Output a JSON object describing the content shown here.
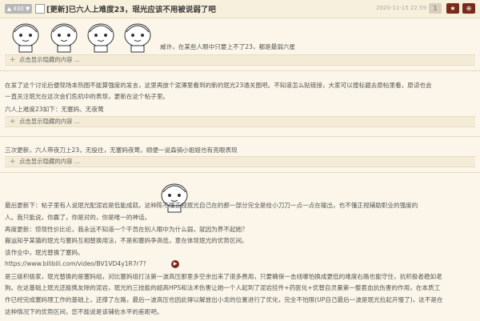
{
  "header": {
    "likes": "▲ 430 ▼",
    "title": "[更新]已六人上难度23，珉光应该不用被说弱了吧",
    "date": "2020-11-15 22:59",
    "btn_a": "1",
    "btn_b": "★",
    "btn_c": "⊕"
  },
  "section1": {
    "caption": "威许，在某些人眼中只要上不了23，都是最弱六星",
    "fold": "点击显示隐藏的内容 ..."
  },
  "section2": {
    "line1": "在发了这个讨论后便现场本热图不能算强度的发言，这里再放个泥潭里看到的新的珉光23通关图吧。不知道怎么贴链接，大家可以搜标题去原帖里看，原谅也会",
    "line2": "一直关注珉光在这次会们危机中的表现，更新在这个帖子里。",
    "line3": "六人上难度23如下：无塞妈、无夜莺",
    "fold": "点击显示隐藏的内容 ..."
  },
  "section3": {
    "line1": "三次更新，六人带夜刀上23，无投往，无塞妈夜莺，顺便一说森骑小姐姐也有亮眼表现",
    "fold": "点击显示隐藏的内容 ..."
  },
  "section4": {
    "line1": "最后更新下：帖子里有人说珉光配泥岩是低能成就，这种陈不懂正视珉光自己在的那一部分完全是给小刀刀一点一点在输出，也不懂正视辅助职业的强度的",
    "line2": "人。我只能说，你赢了，你是对的，你是唯一的神话。",
    "line3": "再度更新：惊现性价比论，我永远不知道一个干员在别人眼中为什么弱，就因为养不起她？",
    "line4": "搬运知乎某猫的珉光与塞妈互相替换用法，不是和塞妈争高低，意在体现珉光的优势区间。",
    "line5": "该作业中，珉光替换了塞妈。",
    "url": "https://www.bilibili.com/video/BV1VD4y1R7r7?",
    "pill": "▶",
    "line6": "是三级积极家，珉光替换的是塞妈组，对比塞妈组打法第一波高压那里多空余出来了很多费用，只要确保一击线哪怕换成更低的难度右路也能守住，抗积极者稳如老",
    "line7": "狗。在这基础上珉光还能携友除的泥岩，珉光的三技能的超高HPS和法术伤害让她一个人起到了泥岩挂件+药医化+优替自灵量第一整套血抗伤害的作用，在本质工",
    "line8": "作已经完成塞妈理工作的基础上，还撑了左路，最后一波高压也因此得以解放出小龙的位置进行了优化，完全不怕限(UP自己最后一波是珉光拉起开慢了)，这不是在",
    "line9": "这种情况下的优势区间，您不能说是该辅佐水平的差距吧。"
  }
}
